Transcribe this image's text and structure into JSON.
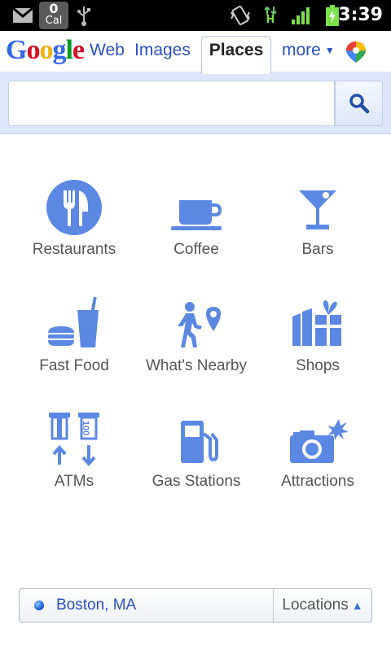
{
  "status_bar": {
    "calendar_count": "0",
    "calendar_label": "Cal",
    "network_label": "H",
    "time": "3:39",
    "icons": [
      "gmail-icon",
      "usb-icon",
      "vibrate-icon",
      "network-activity-icon",
      "signal-icon",
      "battery-charging-icon"
    ]
  },
  "header": {
    "logo_text": "Google",
    "tabs": [
      {
        "label": "Web"
      },
      {
        "label": "Images"
      },
      {
        "label": "Places"
      },
      {
        "label": "more"
      }
    ],
    "active_tab": "Places"
  },
  "search": {
    "placeholder": "",
    "value": ""
  },
  "categories": [
    {
      "label": "Restaurants",
      "icon": "restaurant-icon"
    },
    {
      "label": "Coffee",
      "icon": "coffee-icon"
    },
    {
      "label": "Bars",
      "icon": "cocktail-icon"
    },
    {
      "label": "Fast Food",
      "icon": "fast-food-icon"
    },
    {
      "label": "What's Nearby",
      "icon": "walking-person-pin-icon"
    },
    {
      "label": "Shops",
      "icon": "shopping-icon"
    },
    {
      "label": "ATMs",
      "icon": "atm-icon"
    },
    {
      "label": "Gas Stations",
      "icon": "gas-pump-icon"
    },
    {
      "label": "Attractions",
      "icon": "camera-icon"
    }
  ],
  "location": {
    "city": "Boston, MA",
    "button_label": "Locations"
  },
  "colors": {
    "accent": "#5b88e2",
    "link": "#2a4fc2",
    "search_band": "#dde7f9"
  }
}
